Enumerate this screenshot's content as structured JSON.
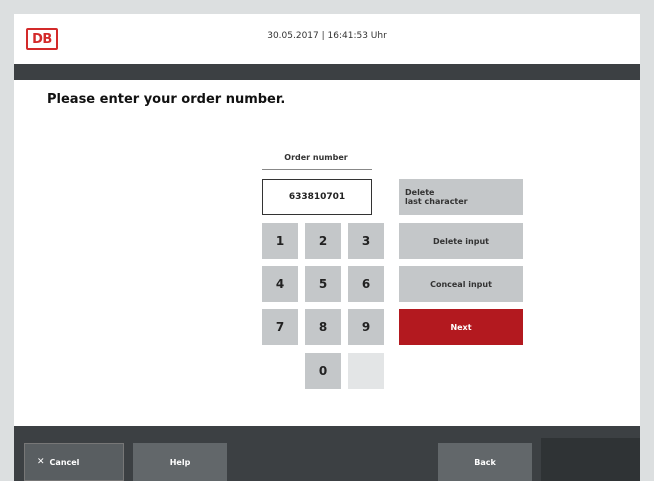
{
  "header": {
    "logo": "DB",
    "datetime": "30.05.2017 | 16:41:53 Uhr"
  },
  "prompt": "Please enter your order number.",
  "order": {
    "label": "Order number",
    "value": "633810701"
  },
  "keypad": {
    "keys": [
      "1",
      "2",
      "3",
      "4",
      "5",
      "6",
      "7",
      "8",
      "9",
      "0"
    ]
  },
  "actions": {
    "delete_last_line1": "Delete",
    "delete_last_line2": "last character",
    "delete_input": "Delete input",
    "conceal_input": "Conceal input",
    "next": "Next"
  },
  "footer": {
    "cancel": "Cancel",
    "help": "Help",
    "back": "Back"
  },
  "colors": {
    "brand_red": "#b3191f",
    "logo_red": "#d32a2a",
    "dark_bar": "#3c4043",
    "key_gray": "#c4c7c9"
  }
}
